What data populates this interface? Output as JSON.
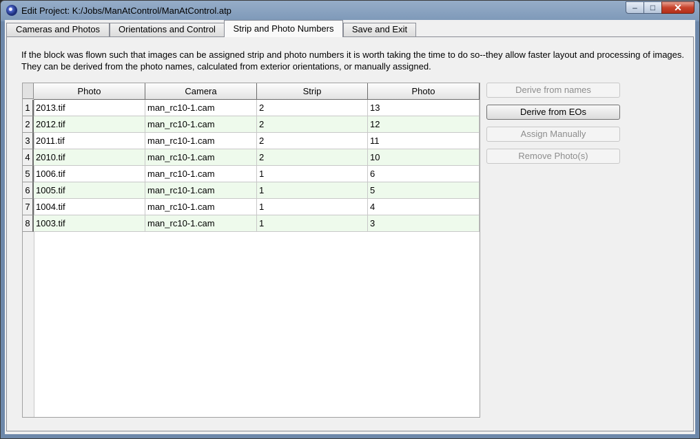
{
  "window": {
    "title": "Edit Project:  K:/Jobs/ManAtControl/ManAtControl.atp",
    "controls": {
      "minimize": "–",
      "maximize": "□",
      "close": "✕"
    }
  },
  "tabs": [
    {
      "label": "Cameras and Photos",
      "active": false
    },
    {
      "label": "Orientations and Control",
      "active": false
    },
    {
      "label": "Strip and Photo Numbers",
      "active": true
    },
    {
      "label": "Save and Exit",
      "active": false
    }
  ],
  "description": "If the block was flown such that images can be assigned strip and photo numbers it is worth taking the time to do so--they allow faster layout and processing of images.  They can be derived from the photo names, calculated from exterior orientations, or manually assigned.",
  "table": {
    "columns": [
      "Photo",
      "Camera",
      "Strip",
      "Photo"
    ],
    "rows": [
      {
        "num": "1",
        "photo": "2013.tif",
        "camera": "man_rc10-1.cam",
        "strip": "2",
        "photo_num": "13"
      },
      {
        "num": "2",
        "photo": "2012.tif",
        "camera": "man_rc10-1.cam",
        "strip": "2",
        "photo_num": "12"
      },
      {
        "num": "3",
        "photo": "2011.tif",
        "camera": "man_rc10-1.cam",
        "strip": "2",
        "photo_num": "11"
      },
      {
        "num": "4",
        "photo": "2010.tif",
        "camera": "man_rc10-1.cam",
        "strip": "2",
        "photo_num": "10"
      },
      {
        "num": "5",
        "photo": "1006.tif",
        "camera": "man_rc10-1.cam",
        "strip": "1",
        "photo_num": "6"
      },
      {
        "num": "6",
        "photo": "1005.tif",
        "camera": "man_rc10-1.cam",
        "strip": "1",
        "photo_num": "5"
      },
      {
        "num": "7",
        "photo": "1004.tif",
        "camera": "man_rc10-1.cam",
        "strip": "1",
        "photo_num": "4"
      },
      {
        "num": "8",
        "photo": "1003.tif",
        "camera": "man_rc10-1.cam",
        "strip": "1",
        "photo_num": "3"
      }
    ]
  },
  "buttons": {
    "derive_names": {
      "label": "Derive from names",
      "enabled": false
    },
    "derive_eos": {
      "label": "Derive from EOs",
      "enabled": true
    },
    "assign_manually": {
      "label": "Assign Manually",
      "enabled": false
    },
    "remove_photos": {
      "label": "Remove Photo(s)",
      "enabled": false
    }
  },
  "colors": {
    "alt_row": "#eefaec",
    "title_bar": "#7d98b8",
    "close_button": "#c7432c"
  },
  "icons": {
    "app": "app-globe-icon"
  }
}
